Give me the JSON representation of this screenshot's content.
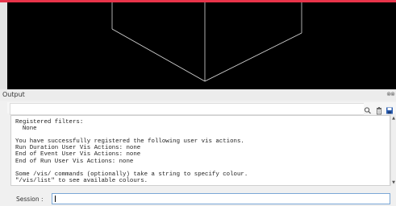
{
  "viewer": {
    "scene": "wireframe-cube",
    "background": "#000000",
    "line_color": "#d8d8d8"
  },
  "output": {
    "title": "Output",
    "header_icons": "⊗⊗"
  },
  "toolbar": {
    "search_placeholder": "",
    "search_icon": "search-icon",
    "clear_icon": "trash-icon",
    "save_icon": "save-icon"
  },
  "console": {
    "lines": [
      "Registered filters:",
      "  None",
      "",
      "You have successfully registered the following user vis actions.",
      "Run Duration User Vis Actions: none",
      "End of Event User Vis Actions: none",
      "End of Run User Vis Actions: none",
      "",
      "Some /vis/ commands (optionally) take a string to specify colour.",
      "\"/vis/list\" to see available colours."
    ]
  },
  "session": {
    "label": "Session :",
    "value": ""
  },
  "colors": {
    "accent_bar": "#e8344a",
    "save_icon": "#2a5db0",
    "session_border": "#7aa7d6"
  }
}
